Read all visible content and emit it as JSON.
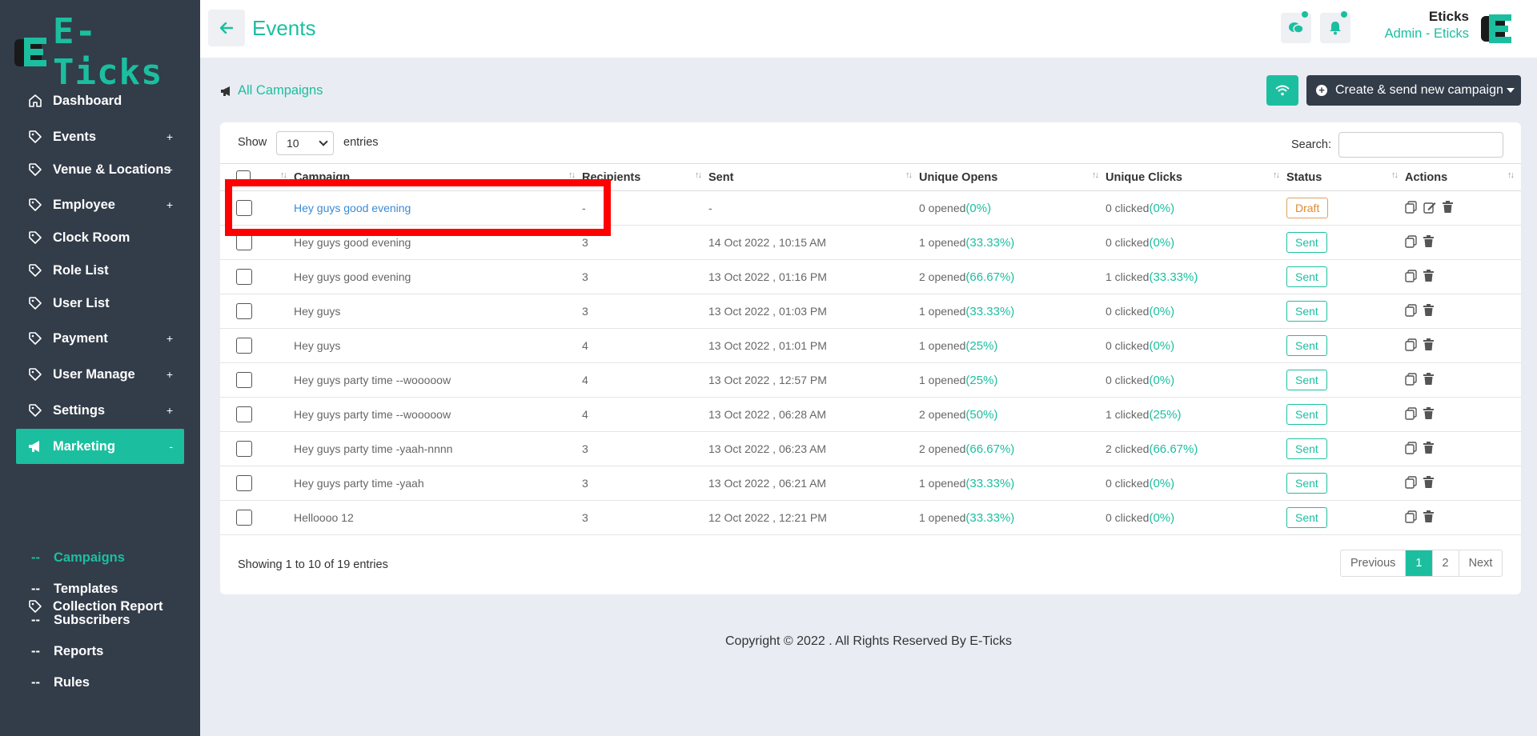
{
  "brand": {
    "logo_text": "E-Ticks",
    "accent": "#1bbfa0",
    "sidebar_bg": "#333c49"
  },
  "sidebar": {
    "items": [
      {
        "label": "Dashboard",
        "icon": "home-icon",
        "expand": ""
      },
      {
        "label": "Events",
        "icon": "tag-icon",
        "expand": "+"
      },
      {
        "label": "Venue & Locations",
        "icon": "tag-icon",
        "expand": "+"
      },
      {
        "label": "Employee",
        "icon": "tag-icon",
        "expand": "+"
      },
      {
        "label": "Clock Room",
        "icon": "tag-icon",
        "expand": ""
      },
      {
        "label": "Role List",
        "icon": "tag-icon",
        "expand": ""
      },
      {
        "label": "User List",
        "icon": "tag-icon",
        "expand": ""
      },
      {
        "label": "Payment",
        "icon": "tag-icon",
        "expand": "+"
      },
      {
        "label": "User Manage",
        "icon": "tag-icon",
        "expand": "+"
      },
      {
        "label": "Settings",
        "icon": "tag-icon",
        "expand": "+"
      },
      {
        "label": "Marketing",
        "icon": "megaphone-icon",
        "expand": "-"
      },
      {
        "label": "Collection Report",
        "icon": "tag-icon",
        "expand": ""
      }
    ],
    "sub_items": [
      {
        "dash": "--",
        "label": "Campaigns"
      },
      {
        "dash": "--",
        "label": "Templates"
      },
      {
        "dash": "--",
        "label": "Subscribers"
      },
      {
        "dash": "--",
        "label": "Reports"
      },
      {
        "dash": "--",
        "label": "Rules"
      }
    ]
  },
  "header": {
    "title": "Events",
    "user_name": "Eticks",
    "user_role": "Admin - Eticks"
  },
  "toolbar": {
    "all_campaigns": "All Campaigns",
    "create_label": "Create & send new campaign"
  },
  "table_controls": {
    "show": "Show",
    "page_size": "10",
    "entries": "entries",
    "search": "Search:"
  },
  "table": {
    "columns": [
      "Campaign",
      "Recipients",
      "Sent",
      "Unique Opens",
      "Unique Clicks",
      "Status",
      "Actions"
    ],
    "rows": [
      {
        "campaign": "Hey guys good evening",
        "recipients": "-",
        "sent": "-",
        "opens": "0 opened",
        "opens_pct": "(0%)",
        "clicks": "0 clicked",
        "clicks_pct": "(0%)",
        "status": "Draft"
      },
      {
        "campaign": "Hey guys good evening",
        "recipients": "3",
        "sent": "14 Oct 2022 , 10:15 AM",
        "opens": "1 opened",
        "opens_pct": "(33.33%)",
        "clicks": "0 clicked",
        "clicks_pct": "(0%)",
        "status": "Sent"
      },
      {
        "campaign": "Hey guys good evening",
        "recipients": "3",
        "sent": "13 Oct 2022 , 01:16 PM",
        "opens": "2 opened",
        "opens_pct": "(66.67%)",
        "clicks": "1 clicked",
        "clicks_pct": "(33.33%)",
        "status": "Sent"
      },
      {
        "campaign": "Hey guys",
        "recipients": "3",
        "sent": "13 Oct 2022 , 01:03 PM",
        "opens": "1 opened",
        "opens_pct": "(33.33%)",
        "clicks": "0 clicked",
        "clicks_pct": "(0%)",
        "status": "Sent"
      },
      {
        "campaign": "Hey guys",
        "recipients": "4",
        "sent": "13 Oct 2022 , 01:01 PM",
        "opens": "1 opened",
        "opens_pct": "(25%)",
        "clicks": "0 clicked",
        "clicks_pct": "(0%)",
        "status": "Sent"
      },
      {
        "campaign": "Hey guys party time --wooooow",
        "recipients": "4",
        "sent": "13 Oct 2022 , 12:57 PM",
        "opens": "1 opened",
        "opens_pct": "(25%)",
        "clicks": "0 clicked",
        "clicks_pct": "(0%)",
        "status": "Sent"
      },
      {
        "campaign": "Hey guys party time --wooooow",
        "recipients": "4",
        "sent": "13 Oct 2022 , 06:28 AM",
        "opens": "2 opened",
        "opens_pct": "(50%)",
        "clicks": "1 clicked",
        "clicks_pct": "(25%)",
        "status": "Sent"
      },
      {
        "campaign": "Hey guys party time -yaah-nnnn",
        "recipients": "3",
        "sent": "13 Oct 2022 , 06:23 AM",
        "opens": "2 opened",
        "opens_pct": "(66.67%)",
        "clicks": "2 clicked",
        "clicks_pct": "(66.67%)",
        "status": "Sent"
      },
      {
        "campaign": "Hey guys party time -yaah",
        "recipients": "3",
        "sent": "13 Oct 2022 , 06:21 AM",
        "opens": "1 opened",
        "opens_pct": "(33.33%)",
        "clicks": "0 clicked",
        "clicks_pct": "(0%)",
        "status": "Sent"
      },
      {
        "campaign": "Helloooo 12",
        "recipients": "3",
        "sent": "12 Oct 2022 , 12:21 PM",
        "opens": "1 opened",
        "opens_pct": "(33.33%)",
        "clicks": "0 clicked",
        "clicks_pct": "(0%)",
        "status": "Sent"
      }
    ]
  },
  "footer_info": {
    "showing": "Showing 1 to 10 of 19 entries",
    "previous": "Previous",
    "pages": [
      "1",
      "2"
    ],
    "next": "Next"
  },
  "copyright": "Copyright © 2022 . All Rights Reserved By E-Ticks"
}
